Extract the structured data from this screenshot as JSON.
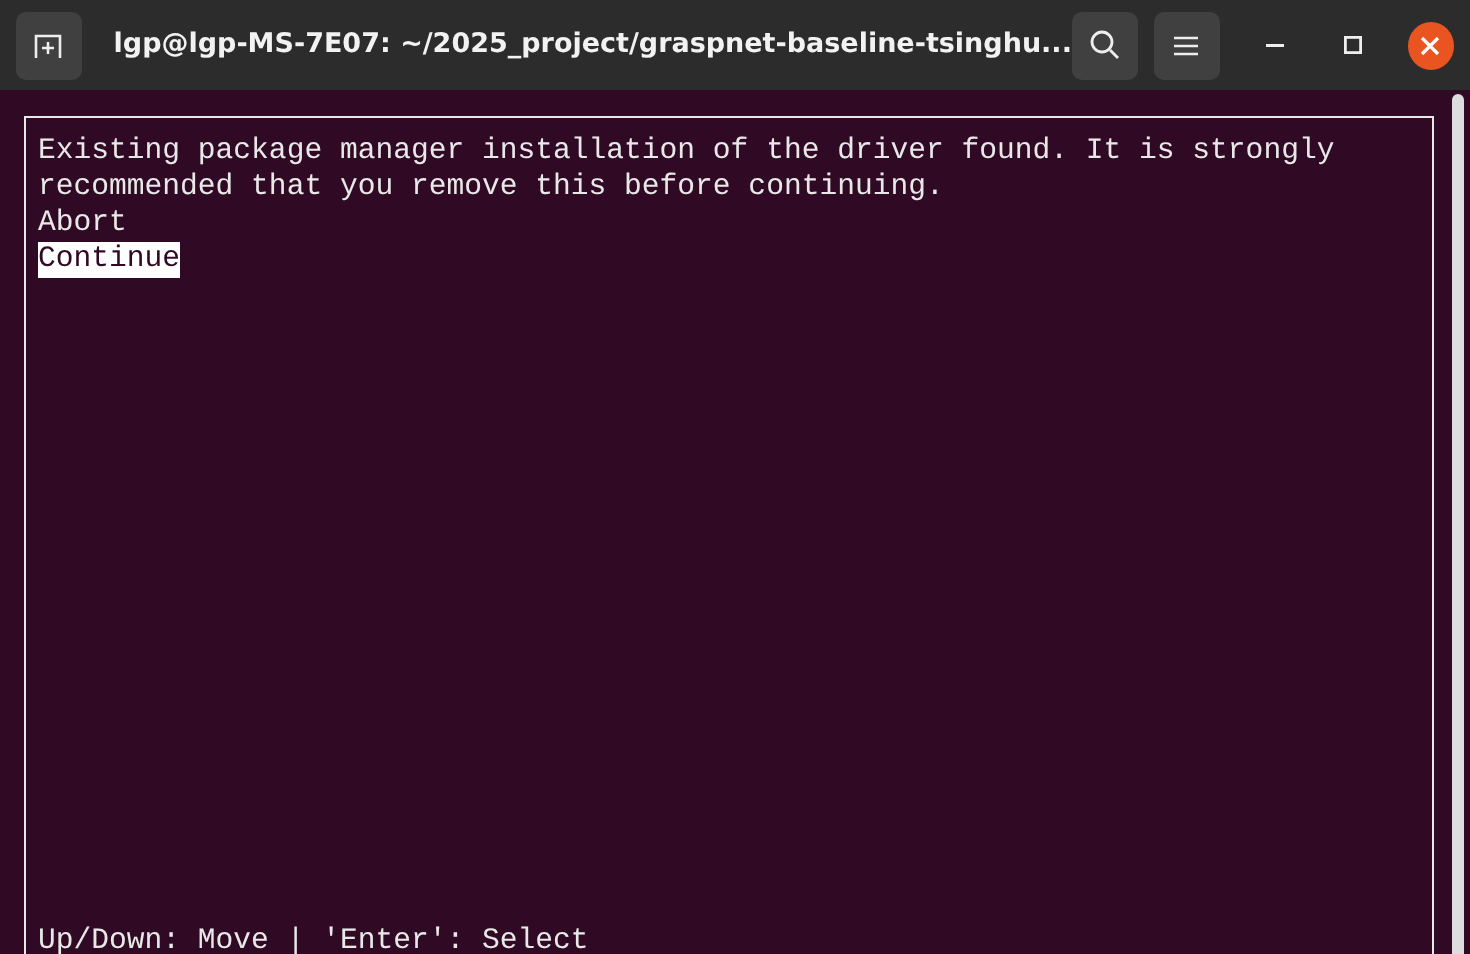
{
  "window": {
    "title": "lgp@lgp-MS-7E07: ~/2025_project/graspnet-baseline-tsinghu..."
  },
  "dialog": {
    "message": "Existing package manager installation of the driver found. It is strongly recommended that you remove this before continuing.",
    "options": [
      {
        "label": "Abort",
        "selected": false
      },
      {
        "label": "Continue",
        "selected": true
      }
    ],
    "help": "Up/Down: Move | 'Enter': Select"
  }
}
